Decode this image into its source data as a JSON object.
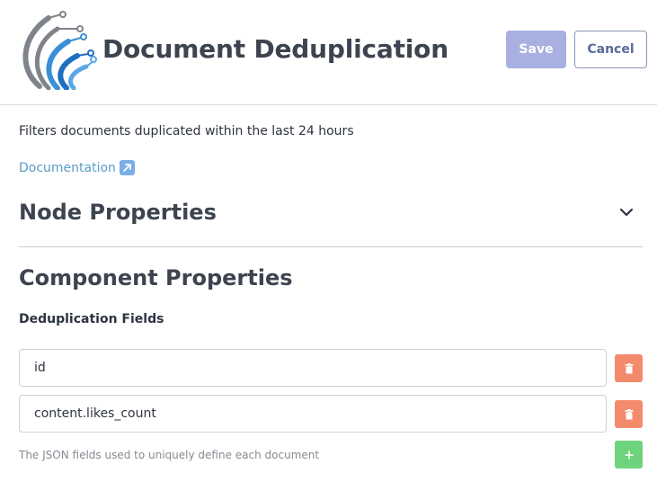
{
  "header": {
    "title": "Document Deduplication",
    "save_label": "Save",
    "cancel_label": "Cancel"
  },
  "logo": {
    "icon": "circuit-arcs-logo",
    "colors": [
      "#7f848b",
      "#3a8fd8",
      "#1f6fc0",
      "#5aa7e8"
    ]
  },
  "description": "Filters documents duplicated within the last 24 hours",
  "documentation": {
    "label": "Documentation",
    "icon": "external-link-icon"
  },
  "node_properties": {
    "title": "Node Properties",
    "expanded": false,
    "icon": "chevron-down-icon"
  },
  "component_properties": {
    "title": "Component Properties",
    "dedup_fields": {
      "label": "Deduplication Fields",
      "values": [
        "id",
        "content.likes_count"
      ],
      "help": "The JSON fields used to uniquely define each document",
      "delete_icon": "trash-icon",
      "add_icon": "plus-icon"
    }
  },
  "colors": {
    "save_bg": "#a7b0e0",
    "delete_bg": "#f48a6c",
    "add_bg": "#6fd37e",
    "link": "#5b9bc9"
  }
}
